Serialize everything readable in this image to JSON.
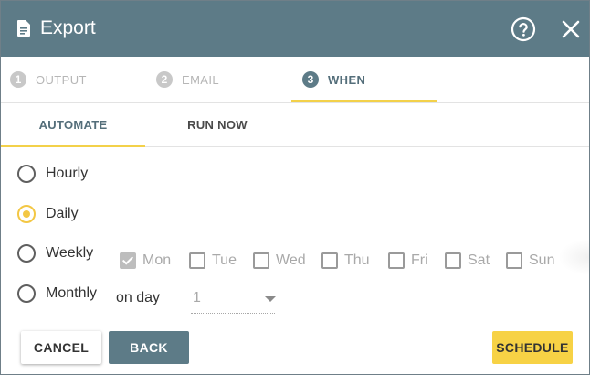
{
  "header": {
    "title": "Export",
    "icons": {
      "document": "document-icon",
      "help": "help-icon",
      "close": "close-icon"
    }
  },
  "steps": [
    {
      "number": "1",
      "label": "OUTPUT",
      "active": false
    },
    {
      "number": "2",
      "label": "EMAIL",
      "active": false
    },
    {
      "number": "3",
      "label": "WHEN",
      "active": true
    }
  ],
  "subtabs": [
    {
      "label": "AUTOMATE",
      "active": true
    },
    {
      "label": "RUN NOW",
      "active": false
    }
  ],
  "frequency": {
    "options": [
      "Hourly",
      "Daily",
      "Weekly",
      "Monthly"
    ],
    "selected": "Daily"
  },
  "weekdays": [
    {
      "label": "Mon",
      "checked": true
    },
    {
      "label": "Tue",
      "checked": false
    },
    {
      "label": "Wed",
      "checked": false
    },
    {
      "label": "Thu",
      "checked": false
    },
    {
      "label": "Fri",
      "checked": false
    },
    {
      "label": "Sat",
      "checked": false
    },
    {
      "label": "Sun",
      "checked": false
    }
  ],
  "monthly": {
    "on_day_label": "on day",
    "day_value": "1"
  },
  "footer": {
    "cancel": "CANCEL",
    "back": "BACK",
    "schedule": "SCHEDULE"
  },
  "colors": {
    "header": "#5d7b87",
    "accent": "#f3d14a",
    "active_text": "#546e7a"
  }
}
